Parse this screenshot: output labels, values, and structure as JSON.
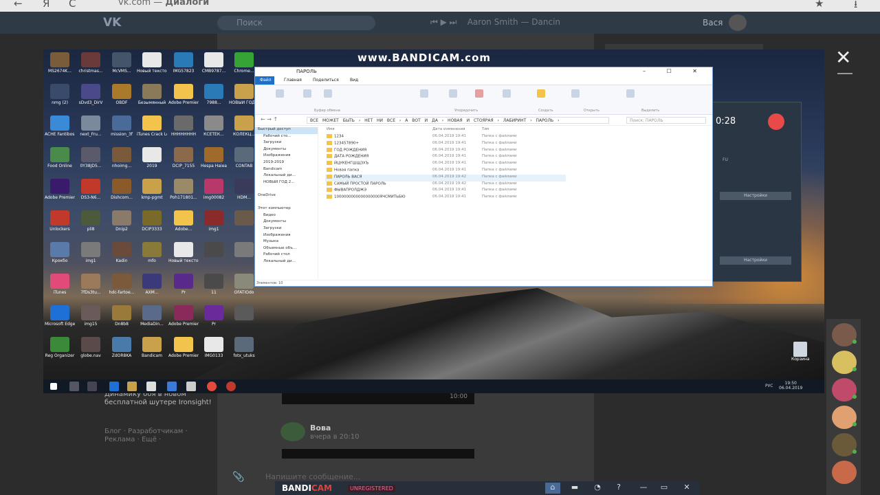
{
  "browser": {
    "back": "←",
    "reload": "Я",
    "refresh": "C",
    "url_host": "vk.com",
    "url_sep": " — ",
    "url_title": "Диалоги",
    "bookmark": "★",
    "download": "⭳"
  },
  "vk": {
    "logo": "VK",
    "search_placeholder": "Поиск",
    "player_track": "Aaron Smith — Dancin",
    "user_name": "Вася",
    "left_ad": "идут и находят кейсы. Динамику боя в новом бесплатной шутере Ironsight!",
    "left_links": "Блог · Разработчикам · Реклама · Ещё ·",
    "video_duration": "10:00",
    "msg_author": "Вова",
    "msg_time": "вчера в 20:10",
    "compose_placeholder": "Напишите сообщение..."
  },
  "viewer": {
    "close": "✕"
  },
  "desktop": {
    "watermark": "www.BANDICAM.com",
    "icons": [
      {
        "label": "MS2674K...",
        "color": "#7a5b3a"
      },
      {
        "label": "christmas...",
        "color": "#6a3a3a"
      },
      {
        "label": "McVMS...",
        "color": "#44556a"
      },
      {
        "label": "Новый текстов...",
        "color": "#e8e8e8"
      },
      {
        "label": "IMG57823",
        "color": "#2a7ab8"
      },
      {
        "label": "CMB9787...",
        "color": "#e8e8e8"
      },
      {
        "label": "Chrome...",
        "color": "#36a336"
      },
      {
        "label": "nmg (2)",
        "color": "#3a4a6a"
      },
      {
        "label": "sDvd3_DirV",
        "color": "#4a4a8a"
      },
      {
        "label": "OBDF",
        "color": "#aa7a2a"
      },
      {
        "label": "Безымянный",
        "color": "#8a7a5a"
      },
      {
        "label": "Adobe Premiere P...",
        "color": "#f2c44b"
      },
      {
        "label": "7988...",
        "color": "#2a7ab8"
      },
      {
        "label": "НОВЫЙ ГОД 2019",
        "color": "#c9a14a"
      },
      {
        "label": "ACHE Fantibos...",
        "color": "#3a8ad8"
      },
      {
        "label": "next_Fru...",
        "color": "#7a8a9a"
      },
      {
        "label": "mission_3f",
        "color": "#4a6a9a"
      },
      {
        "label": "iTunes Crack Login",
        "color": "#f2c44b"
      },
      {
        "label": "HHHHHHHH",
        "color": "#6a6a6a"
      },
      {
        "label": "КСЕТЁК...",
        "color": "#8a8a8a"
      },
      {
        "label": "КОЛЕКЦ...",
        "color": "#c9a14a"
      },
      {
        "label": "Food Online",
        "color": "#4a8a4a"
      },
      {
        "label": "0Y38JD5...",
        "color": "#5a5a6a"
      },
      {
        "label": "nhoimg...",
        "color": "#7a5a3a"
      },
      {
        "label": "2019",
        "color": "#e8e8e8"
      },
      {
        "label": "DCIP_7155",
        "color": "#8a6a4a"
      },
      {
        "label": "Hespa Haiea",
        "color": "#a06a2a"
      },
      {
        "label": "CONTAB",
        "color": "#5a6a7a"
      },
      {
        "label": "Adobe Premiere...",
        "color": "#3a1a6a"
      },
      {
        "label": "DS3-N6...",
        "color": "#c0392b"
      },
      {
        "label": "Dishcom...",
        "color": "#8a5a2a"
      },
      {
        "label": "kmp-pgmt",
        "color": "#c9a14a"
      },
      {
        "label": "Poh171801...",
        "color": "#9a8a6a"
      },
      {
        "label": "img00082",
        "color": "#b8386a"
      },
      {
        "label": "HDM...",
        "color": "#3a3a5a"
      },
      {
        "label": "Unlockers",
        "color": "#c0392b"
      },
      {
        "label": "pli8",
        "color": "#4a5a3a"
      },
      {
        "label": "Dnip2",
        "color": "#8a7a6a"
      },
      {
        "label": "DCIP3333",
        "color": "#7a6a2a"
      },
      {
        "label": "Adobe...",
        "color": "#f2c44b"
      },
      {
        "label": "img1",
        "color": "#8a2a2a"
      },
      {
        "label": "",
        "color": "#6a5a4a"
      },
      {
        "label": "Крокбо",
        "color": "#5a7aaa"
      },
      {
        "label": "img1",
        "color": "#7a7a7a"
      },
      {
        "label": "Kadin",
        "color": "#6a4a3a"
      },
      {
        "label": "mfo",
        "color": "#8a7a3a"
      },
      {
        "label": "Новый текстов...",
        "color": "#e8e8e8"
      },
      {
        "label": "",
        "color": "#4a4a4a"
      },
      {
        "label": "",
        "color": "#7a7a7a"
      },
      {
        "label": "iTunes",
        "color": "#e24a7a"
      },
      {
        "label": "7fDs3tu...",
        "color": "#9a7a5a"
      },
      {
        "label": "hdc-fartoe...",
        "color": "#7a5a3a"
      },
      {
        "label": "AXM...",
        "color": "#3a3a7a"
      },
      {
        "label": "Pr",
        "color": "#5a2a8a"
      },
      {
        "label": "11",
        "color": "#4a4a4a"
      },
      {
        "label": "OFATIOdo",
        "color": "#8a8a7a"
      },
      {
        "label": "Microsoft Edge",
        "color": "#1e6fd6"
      },
      {
        "label": "img15",
        "color": "#6a5a5a"
      },
      {
        "label": "Dn8b8",
        "color": "#9a7a3a"
      },
      {
        "label": "MediaDin...",
        "color": "#5a6a8a"
      },
      {
        "label": "Adobe Premiere...",
        "color": "#8a2a5a"
      },
      {
        "label": "Pr",
        "color": "#6a2a9a"
      },
      {
        "label": "",
        "color": "#5a5a5a"
      },
      {
        "label": "Reg Organizer",
        "color": "#3a8a3a"
      },
      {
        "label": "globe.nav",
        "color": "#5a4a4a"
      },
      {
        "label": "ZdOR8KA",
        "color": "#4a7aaa"
      },
      {
        "label": "Bandicam",
        "color": "#c9a14a"
      },
      {
        "label": "Adobe Premiere...",
        "color": "#f2c44b"
      },
      {
        "label": "IMG0133",
        "color": "#e8e8e8"
      },
      {
        "label": "fotx_utuks",
        "color": "#5a6a7a"
      }
    ],
    "recycle_label": "Корзина",
    "clock_time": "19:50",
    "clock_date": "06.04.2019",
    "taskbar_lang": "РУС"
  },
  "bandicam_panel": {
    "time": "0:28",
    "btn1": "Настройки",
    "btn2": "Настройки",
    "label": "FU"
  },
  "explorer": {
    "title": "ПАРОЛЬ",
    "window_controls": "– ☐ ✕",
    "tabs": [
      "Файл",
      "Главная",
      "Поделиться",
      "Вид"
    ],
    "ribbon_groups": [
      "Буфер обмена",
      "Упорядочить",
      "Создать",
      "Открыть",
      "Выделить"
    ],
    "path": "ВСЕ МОЖЕТ БЫТЬ › НЕТ НИ ВСЕ › А ВОТ И ДА › НОВАЯ И СТОЯРАЯ › ЛАБИРИНТ › ПАРОЛЬ ›",
    "search": "Поиск: ПАРОЛЬ",
    "nav": [
      {
        "label": "Быстрый доступ",
        "top": true,
        "sel": true
      },
      {
        "label": "Рабочий сто..."
      },
      {
        "label": "Загрузки"
      },
      {
        "label": "Документы"
      },
      {
        "label": "Изображения"
      },
      {
        "label": "2019-2019"
      },
      {
        "label": "Bandicam"
      },
      {
        "label": "Локальный ди..."
      },
      {
        "label": "НОВЫЙ ГОД 2..."
      },
      {
        "label": ""
      },
      {
        "label": "OneDrive",
        "top": true
      },
      {
        "label": ""
      },
      {
        "label": "Этот компьютер",
        "top": true
      },
      {
        "label": "Видео"
      },
      {
        "label": "Документы"
      },
      {
        "label": "Загрузки"
      },
      {
        "label": "Изображения"
      },
      {
        "label": "Музыка"
      },
      {
        "label": "Объемные объ..."
      },
      {
        "label": "Рабочий стол"
      },
      {
        "label": "Локальный ди..."
      }
    ],
    "columns": [
      "Имя",
      "Дата изменения",
      "Тип"
    ],
    "files": [
      {
        "name": "1234",
        "date": "06.04.2019 19:41",
        "type": "Папка с файлами"
      },
      {
        "name": "123457890+",
        "date": "06.04.2019 19:41",
        "type": "Папка с файлами"
      },
      {
        "name": "ГОД РОЖДЕНИЯ",
        "date": "06.04.2019 19:41",
        "type": "Папка с файлами"
      },
      {
        "name": "ДАТА РОЖДЕНИЯ",
        "date": "06.04.2019 19:41",
        "type": "Папка с файлами"
      },
      {
        "name": "ЙЦУКЕНГШЩЗХЪ",
        "date": "06.04.2019 19:41",
        "type": "Папка с файлами"
      },
      {
        "name": "Новая папка",
        "date": "06.04.2019 19:41",
        "type": "Папка с файлами"
      },
      {
        "name": "ПАРОЛЬ ВАСЯ",
        "date": "06.04.2019 19:42",
        "type": "Папка с файлами",
        "sel": true
      },
      {
        "name": "САМЫЙ ПРОСТОЙ ПАРОЛЬ",
        "date": "06.04.2019 19:42",
        "type": "Папка с файлами"
      },
      {
        "name": "ФЫВАПРОЛДЖЭ",
        "date": "06.04.2019 19:41",
        "type": "Папка с файлами"
      },
      {
        "name": "1000000000000000000ЯЧСМИТЬБЮ",
        "date": "06.04.2019 19:41",
        "type": "Папка с файлами"
      }
    ],
    "status": "Элементов: 10"
  },
  "bandibar": {
    "logo_a": "BANDI",
    "logo_b": "CAM",
    "unreg": "UNREGISTERED",
    "icons": [
      "⌂",
      "▬",
      "◔",
      "?",
      "—",
      "▭",
      "✕"
    ]
  }
}
